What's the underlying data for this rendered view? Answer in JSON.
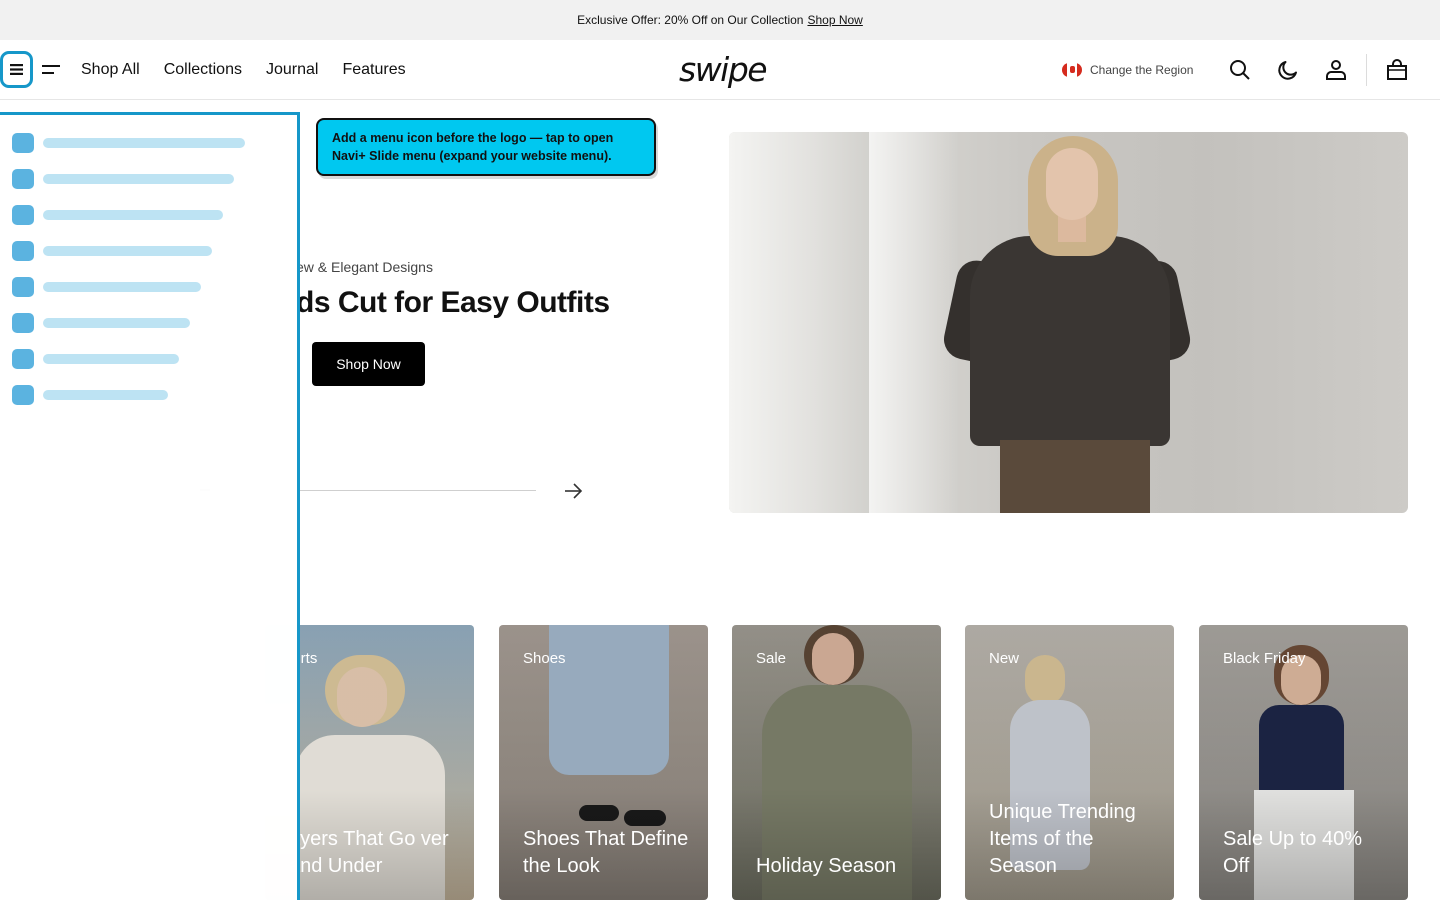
{
  "announcement": {
    "text": "Exclusive Offer: 20% Off on Our Collection",
    "link": "Shop Now"
  },
  "header": {
    "nav": [
      "Shop All",
      "Collections",
      "Journal",
      "Features"
    ],
    "logo": "swipe",
    "region_label": "Change the Region",
    "icons": [
      "search-icon",
      "moon-icon",
      "account-icon",
      "bag-icon"
    ]
  },
  "hero": {
    "subtitle": "ew & Elegant Designs",
    "title": "ds Cut for Easy Outfits",
    "button": "Shop Now",
    "progress": 0.03
  },
  "tooltip": {
    "text": "Add a menu icon before the logo — tap to open Navi+ Slide menu (expand your website menu)."
  },
  "slide_panel": {
    "item_count": 8
  },
  "cards": [
    {
      "tag": "",
      "caption": "",
      "colors": [
        "#efeeec",
        "#f7f6f4"
      ]
    },
    {
      "tag": "hirts",
      "caption": "ayers That Go ver and Under",
      "colors": [
        "#8fa9bc",
        "#c9b99f"
      ]
    },
    {
      "tag": "Shoes",
      "caption": "Shoes That Define the Look",
      "colors": [
        "#a39a92",
        "#8a827a"
      ]
    },
    {
      "tag": "Sale",
      "caption": "Holiday Season",
      "colors": [
        "#9b978f",
        "#6f7062"
      ]
    },
    {
      "tag": "New",
      "caption": "Unique Trending Items of the Season",
      "colors": [
        "#b6b2ab",
        "#a69f90"
      ]
    },
    {
      "tag": "Black Friday",
      "caption": "Sale Up to 40% Off",
      "colors": [
        "#a5a29d",
        "#8d8a85"
      ]
    }
  ],
  "colors": {
    "accent_blue": "#1697c9",
    "tooltip_bg": "#00c8f0",
    "button_bg": "#000000"
  }
}
